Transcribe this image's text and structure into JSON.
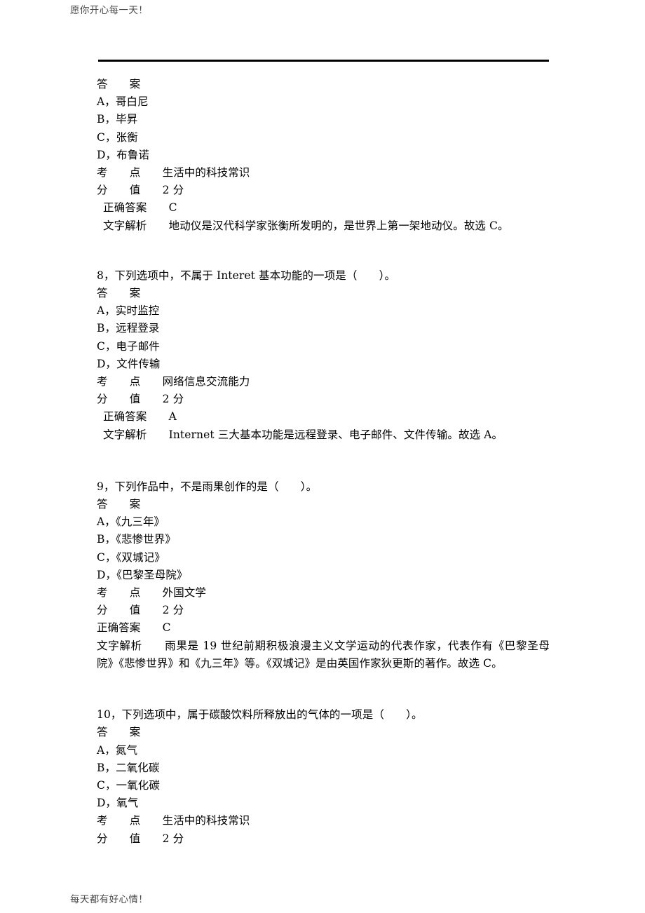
{
  "page": {
    "running_header": "愿你开心每一天！",
    "running_footer": "每天都有好心情！"
  },
  "blocks": {
    "q7_continued": {
      "answer_label": "答　　案",
      "options": [
        "A，哥白尼",
        "B，毕昇",
        "C，张衡",
        "D，布鲁诺"
      ],
      "knowledge_point": "考　　点　　生活中的科技常识",
      "score": "分　　值　　2 分",
      "correct_answer": "正确答案　　C",
      "analysis_label": "文字解析　　",
      "analysis_text": "地动仪是汉代科学家张衡所发明的，是世界上第一架地动仪。故选 C。"
    },
    "q8": {
      "question": "8，下列选项中，不属于 Interet 基本功能的一项是（　　）。",
      "answer_label": "答　　案",
      "options": [
        "A，实时监控",
        "B，远程登录",
        "C，电子邮件",
        "D，文件传输"
      ],
      "knowledge_point": "考　　点　　网络信息交流能力",
      "score": "分　　值　　2 分",
      "correct_answer": "正确答案　　A",
      "analysis_label": "文字解析　　",
      "analysis_text": "Internet 三大基本功能是远程登录、电子邮件、文件传输。故选 A。"
    },
    "q9": {
      "question": "9，下列作品中，不是雨果创作的是（　　）。",
      "answer_label": "答　　案",
      "options": [
        "A，《九三年》",
        "B，《悲惨世界》",
        "C，《双城记》",
        "D，《巴黎圣母院》"
      ],
      "knowledge_point": "考　　点　　外国文学",
      "score": "分　　值　　2 分",
      "correct_answer": "正确答案　　C",
      "analysis_label": "文字解析　　",
      "analysis_text": "雨果是 19 世纪前期积极浪漫主义文学运动的代表作家，代表作有《巴黎圣母院》《悲惨世界》和《九三年》等。《双城记》是由英国作家狄更斯的著作。故选 C。"
    },
    "q10": {
      "question": "10，下列选项中，属于碳酸饮料所释放出的气体的一项是（　　）。",
      "answer_label": "答　　案",
      "options": [
        "A，氮气",
        "B，二氧化碳",
        "C，一氧化碳",
        "D，氧气"
      ],
      "knowledge_point": "考　　点　　生活中的科技常识",
      "score": "分　　值　　2 分"
    }
  }
}
